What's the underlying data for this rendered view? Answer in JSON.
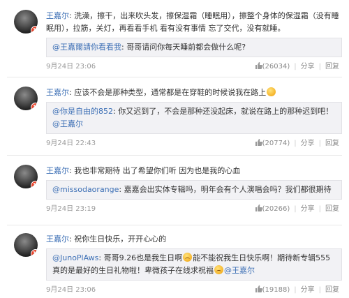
{
  "posts": [
    {
      "author": "王嘉尔",
      "colon": ":",
      "text": " 洗澡，擦干，出来吹头发，擦保湿霜（睡眠用），擦整个身体的保湿霜（没有睡眠用），拉筋，关灯，再看看手机 看有没有事情 忘了交代，没有就睡。",
      "quote_user": "@王嘉爾請你看看我",
      "quote_text": ": 哥哥请问你每天睡前都会做什么呢?",
      "time": "9月24日 23:06",
      "likes": "(26034)",
      "share": "分享",
      "reply": "回复"
    },
    {
      "author": "王嘉尔",
      "colon": ":",
      "text": " 应该不会是那种类型，通常都是在穿鞋的时候说我在路上",
      "quote_user": "@你是自由的852",
      "quote_text": ": 你又迟到了，不会是那种还没起床，就说在路上的那种迟到吧！",
      "quote_mention": "@王嘉尔",
      "time": "9月24日 22:43",
      "likes": "(20774)",
      "share": "分享",
      "reply": "回复"
    },
    {
      "author": "王嘉尔",
      "colon": ":",
      "text": " 我也非常期待 出了希望你们听 因为也是我的心血",
      "quote_user": "@missodaorange",
      "quote_text": ": 嘉嘉会出实体专辑吗，明年会有个人演唱会吗？我们都很期待",
      "time": "9月24日 23:19",
      "likes": "(20266)",
      "share": "分享",
      "reply": "回复"
    },
    {
      "author": "王嘉尔",
      "colon": ":",
      "text": " 祝你生日快乐，开开心心的",
      "quote_user": "@JunoPlAws",
      "quote_text_1": ": 哥哥9.26也是我生日啊",
      "quote_text_2": "能不能祝我生日快乐啊！期待新专辑555真的是最好的生日礼物啦！卑微孩子在线求祝福",
      "quote_mention": "@王嘉尔",
      "time": "9月24日 23:06",
      "likes": "(19188)",
      "share": "分享",
      "reply": "回复"
    }
  ],
  "avatar_badge": "V"
}
